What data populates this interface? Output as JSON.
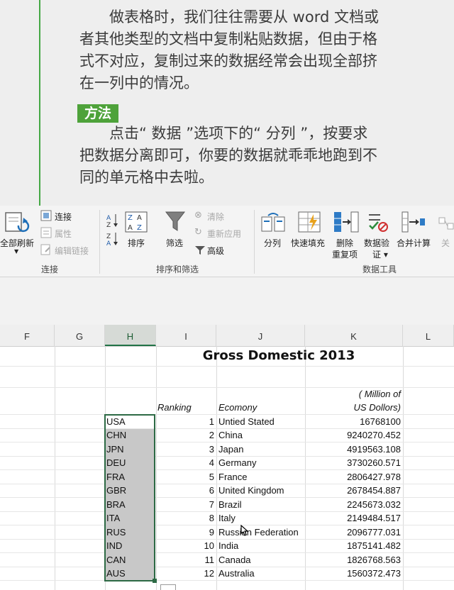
{
  "book": {
    "paragraph1": [
      "做表格时，我们往往需要从 word 文档或",
      "者其他类型的文档中复制粘贴数据，但由于格",
      "式不对应，复制过来的数据经常会出现全部挤",
      "在一列中的情况。"
    ],
    "method_label": "方法",
    "paragraph2": [
      "点击“ 数据 ”选项下的“ 分列 ”，按要求",
      "把数据分离即可，你要的数据就乖乖地跑到不",
      "同的单元格中去啦。"
    ]
  },
  "ribbon": {
    "connections": {
      "refresh_all": "全部刷新",
      "connections": "连接",
      "properties": "属性",
      "edit_links": "编辑链接",
      "group_label": "连接"
    },
    "sort_filter": {
      "sort": "排序",
      "filter": "筛选",
      "clear": "清除",
      "reapply": "重新应用",
      "advanced": "高级",
      "group_label": "排序和筛选"
    },
    "data_tools": {
      "text_to_columns": "分列",
      "flash_fill": "快速填充",
      "remove_duplicates_1": "删除",
      "remove_duplicates_2": "重复项",
      "data_validation_1": "数据验",
      "data_validation_2": "证 ▾",
      "consolidate": "合并计算",
      "relationships": "关",
      "group_label": "数据工具"
    }
  },
  "sheet": {
    "columns": [
      "F",
      "G",
      "H",
      "I",
      "J",
      "K",
      "L"
    ],
    "selected_column": "H",
    "title": "Gross Domestic 2013",
    "header_unit_1": "( Million of",
    "header_unit_2": "US Dollors)",
    "header_ranking": "Ranking",
    "header_economy": "Ecomony",
    "rows": [
      {
        "code": "USA",
        "rank": "1",
        "economy": "Untied Stated",
        "gdp": "16768100"
      },
      {
        "code": "CHN",
        "rank": "2",
        "economy": "China",
        "gdp": "9240270.452"
      },
      {
        "code": "JPN",
        "rank": "3",
        "economy": "Japan",
        "gdp": "4919563.108"
      },
      {
        "code": "DEU",
        "rank": "4",
        "economy": "Germany",
        "gdp": "3730260.571"
      },
      {
        "code": "FRA",
        "rank": "5",
        "economy": "France",
        "gdp": "2806427.978"
      },
      {
        "code": "GBR",
        "rank": "6",
        "economy": "United Kingdom",
        "gdp": "2678454.887"
      },
      {
        "code": "BRA",
        "rank": "7",
        "economy": "Brazil",
        "gdp": "2245673.032"
      },
      {
        "code": "ITA",
        "rank": "8",
        "economy": "Italy",
        "gdp": "2149484.517"
      },
      {
        "code": "RUS",
        "rank": "9",
        "economy": "Russian Federation",
        "gdp": "2096777.031"
      },
      {
        "code": "IND",
        "rank": "10",
        "economy": "India",
        "gdp": "1875141.482"
      },
      {
        "code": "CAN",
        "rank": "11",
        "economy": "Canada",
        "gdp": "1826768.563"
      },
      {
        "code": "AUS",
        "rank": "12",
        "economy": "Australia",
        "gdp": "1560372.473"
      }
    ]
  },
  "colors": {
    "accent_green": "#217346",
    "method_badge": "#4ea23a",
    "margin_line": "#45a845"
  }
}
